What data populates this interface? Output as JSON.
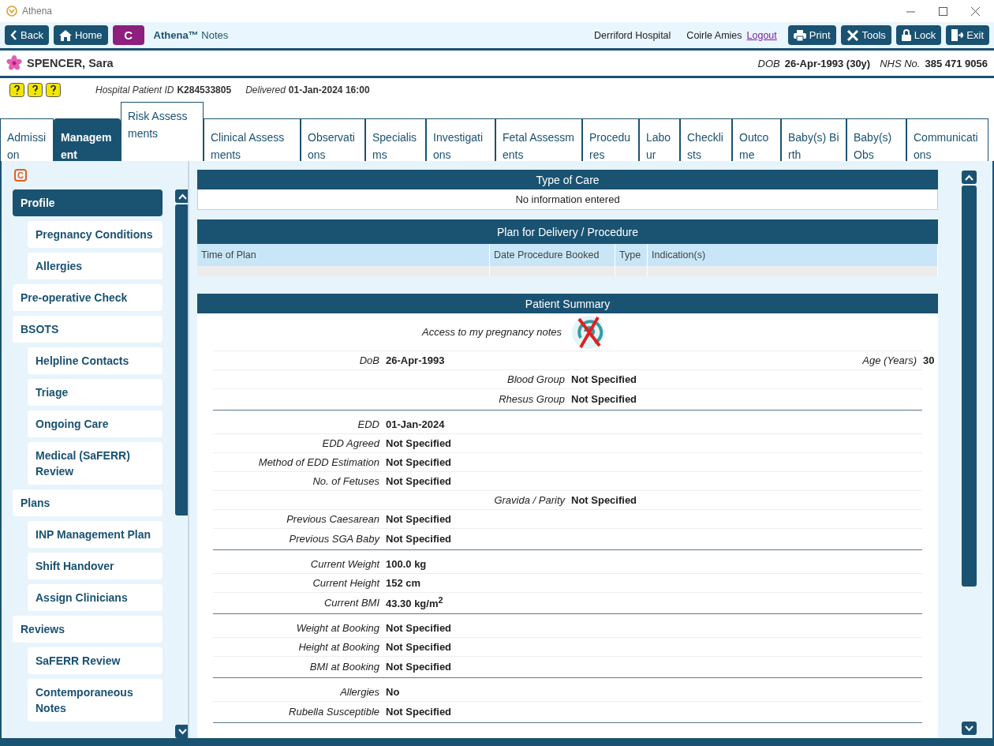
{
  "window": {
    "title": "Athena"
  },
  "toolbar": {
    "left_buttons": [
      {
        "label": "Back",
        "kind": "back"
      },
      {
        "label": "Home",
        "kind": "home"
      }
    ],
    "badge": "C",
    "app_name": "Athena™",
    "app_suffix": "Notes",
    "hospital": "Derriford Hospital",
    "user": "Coirle Amies",
    "logout": "Logout",
    "right_buttons": [
      {
        "label": "Print",
        "kind": "print"
      },
      {
        "label": "Tools",
        "kind": "tools"
      },
      {
        "label": "Lock",
        "kind": "lock"
      },
      {
        "label": "Exit",
        "kind": "exit"
      }
    ]
  },
  "patient": {
    "name": "SPENCER, Sara",
    "dob_label": "DOB",
    "dob": "26-Apr-1993 (30y)",
    "nhs_label": "NHS No.",
    "nhs": "385 471 9056",
    "id_label": "Hospital Patient ID",
    "id": "K284533805",
    "delivered_label": "Delivered",
    "delivered": "01-Jan-2024 16:00"
  },
  "tabs": [
    {
      "label": "Admission",
      "selected": false,
      "raised": false
    },
    {
      "label": "Management",
      "selected": true,
      "raised": false
    },
    {
      "label": "Risk Assessments",
      "selected": false,
      "raised": true
    },
    {
      "label": "Clinical Assessments",
      "selected": false,
      "raised": false
    },
    {
      "label": "Observations",
      "selected": false,
      "raised": false
    },
    {
      "label": "Specialisms",
      "selected": false,
      "raised": false
    },
    {
      "label": "Investigations",
      "selected": false,
      "raised": false
    },
    {
      "label": "Fetal Assessments",
      "selected": false,
      "raised": false
    },
    {
      "label": "Procedures",
      "selected": false,
      "raised": false
    },
    {
      "label": "Labour",
      "selected": false,
      "raised": false
    },
    {
      "label": "Checklists",
      "selected": false,
      "raised": false
    },
    {
      "label": "Outcome",
      "selected": false,
      "raised": false
    },
    {
      "label": "Baby(s) Birth",
      "selected": false,
      "raised": false
    },
    {
      "label": "Baby(s) Obs",
      "selected": false,
      "raised": false
    },
    {
      "label": "Communications",
      "selected": false,
      "raised": false
    }
  ],
  "sidebar": {
    "badge": "C",
    "items": [
      {
        "label": "Profile",
        "selected": true,
        "children": [
          {
            "label": "Pregnancy Conditions",
            "selected": false
          },
          {
            "label": "Allergies",
            "selected": false
          }
        ]
      },
      {
        "label": "Pre-operative Check",
        "selected": false
      },
      {
        "label": "BSOTS",
        "selected": false,
        "children": [
          {
            "label": "Helpline Contacts",
            "selected": false
          },
          {
            "label": "Triage",
            "selected": false
          },
          {
            "label": "Ongoing Care",
            "selected": false
          },
          {
            "label": "Medical (SaFERR) Review",
            "selected": false
          }
        ]
      },
      {
        "label": "Plans",
        "selected": false,
        "children": [
          {
            "label": "INP Management Plan",
            "selected": false
          },
          {
            "label": "Shift Handover",
            "selected": false
          },
          {
            "label": "Assign Clinicians",
            "selected": false
          }
        ]
      },
      {
        "label": "Reviews",
        "selected": false,
        "children": [
          {
            "label": "SaFERR Review",
            "selected": false
          },
          {
            "label": "Contemporaneous Notes",
            "selected": false
          }
        ]
      }
    ]
  },
  "type_of_care": {
    "title": "Type of Care",
    "text": "No information entered"
  },
  "plan": {
    "title": "Plan for Delivery / Procedure",
    "columns": [
      "Time of Plan",
      "Date Procedure Booked",
      "Type",
      "Indication(s)"
    ]
  },
  "summary": {
    "title": "Patient Summary",
    "access_label": "Access to my pregnancy notes",
    "groups": [
      [
        {
          "left": {
            "label": "DoB",
            "value": "26-Apr-1993"
          },
          "right": {
            "label": "Age (Years)",
            "value": "30"
          }
        },
        {
          "middle": {
            "label": "Blood Group",
            "value": "Not Specified"
          }
        },
        {
          "middle": {
            "label": "Rhesus Group",
            "value": "Not Specified"
          }
        }
      ],
      [
        {
          "left": {
            "label": "EDD",
            "value": "01-Jan-2024"
          }
        },
        {
          "left": {
            "label": "EDD Agreed",
            "value": "Not Specified"
          }
        },
        {
          "left": {
            "label": "Method of EDD Estimation",
            "value": "Not Specified"
          }
        },
        {
          "left": {
            "label": "No. of Fetuses",
            "value": "Not Specified"
          }
        },
        {
          "middle": {
            "label": "Gravida / Parity",
            "value": "Not Specified"
          }
        },
        {
          "left": {
            "label": "Previous Caesarean",
            "value": "Not Specified"
          }
        },
        {
          "left": {
            "label": "Previous SGA Baby",
            "value": "Not Specified"
          }
        }
      ],
      [
        {
          "left": {
            "label": "Current Weight",
            "value": "100.0 kg"
          }
        },
        {
          "left": {
            "label": "Current Height",
            "value": "152 cm"
          }
        },
        {
          "left": {
            "label": "Current BMI",
            "value": "43.30 kg/m$^{2}$"
          }
        }
      ],
      [
        {
          "left": {
            "label": "Weight at Booking",
            "value": "Not Specified"
          }
        },
        {
          "left": {
            "label": "Height at Booking",
            "value": "Not Specified"
          }
        },
        {
          "left": {
            "label": "BMI at Booking",
            "value": "Not Specified"
          }
        }
      ],
      [
        {
          "left": {
            "label": "Allergies",
            "value": "No"
          }
        },
        {
          "left": {
            "label": "Rubella Susceptible",
            "value": "Not Specified"
          }
        }
      ]
    ]
  }
}
